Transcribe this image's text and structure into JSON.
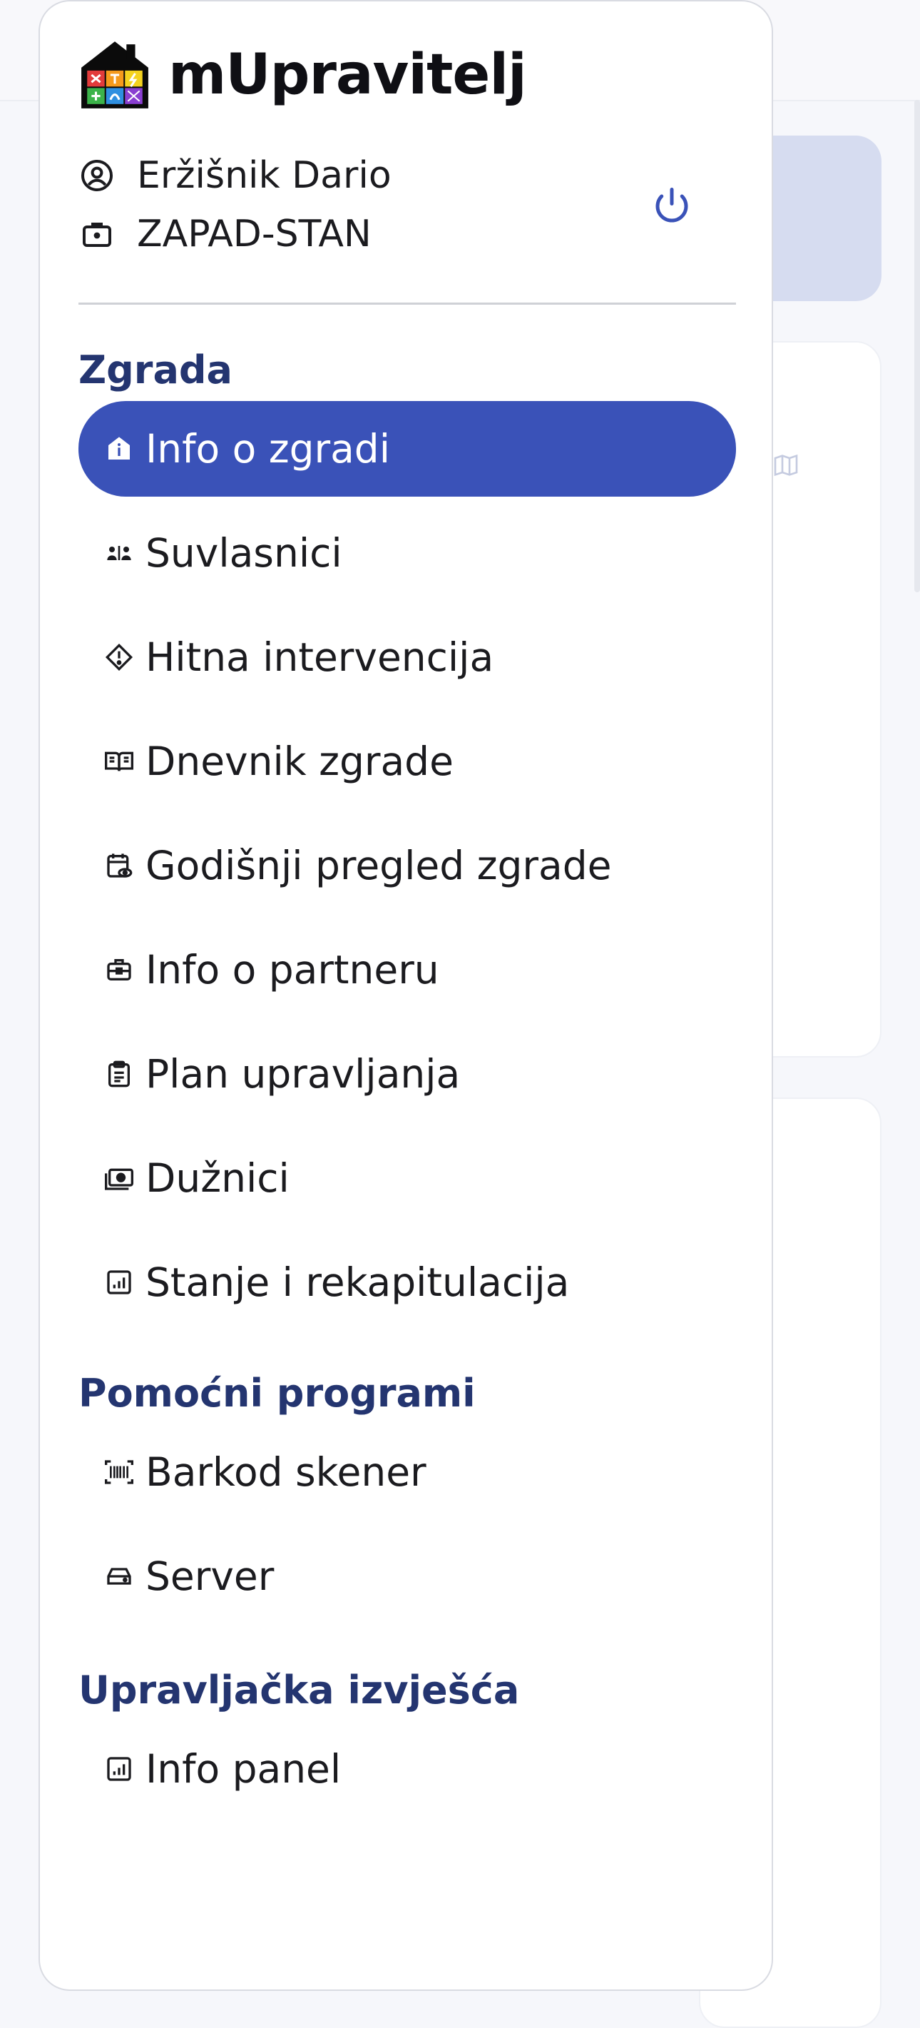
{
  "app": {
    "title": "mUpravitelj"
  },
  "user": {
    "name": "Eržišnik Dario",
    "unit": "ZAPAD-STAN"
  },
  "icons": {
    "user": "user-circle-icon",
    "unit": "briefcase-icon",
    "power": "power-icon"
  },
  "sections": {
    "building": {
      "title": "Zgrada",
      "items": [
        {
          "label": "Info o zgradi",
          "icon": "building-info-icon",
          "active": true
        },
        {
          "label": "Suvlasnici",
          "icon": "users-icon"
        },
        {
          "label": "Hitna intervencija",
          "icon": "warning-diamond-icon"
        },
        {
          "label": "Dnevnik zgrade",
          "icon": "book-open-icon"
        },
        {
          "label": "Godišnji pregled zgrade",
          "icon": "calendar-eye-icon"
        },
        {
          "label": "Info o partneru",
          "icon": "toolbox-icon"
        },
        {
          "label": "Plan upravljanja",
          "icon": "clipboard-icon"
        },
        {
          "label": "Dužnici",
          "icon": "money-icon"
        },
        {
          "label": "Stanje i rekapitulacija",
          "icon": "chart-icon"
        }
      ]
    },
    "tools": {
      "title": "Pomoćni programi",
      "items": [
        {
          "label": "Barkod skener",
          "icon": "barcode-icon"
        },
        {
          "label": "Server",
          "icon": "server-icon"
        }
      ]
    },
    "reports": {
      "title": "Upravljačka izvješća",
      "items": [
        {
          "label": "Info panel",
          "icon": "chart-icon"
        }
      ]
    }
  },
  "colors": {
    "accent": "#3a52b8",
    "section_title": "#243570",
    "banner": "#d6dcf0"
  }
}
